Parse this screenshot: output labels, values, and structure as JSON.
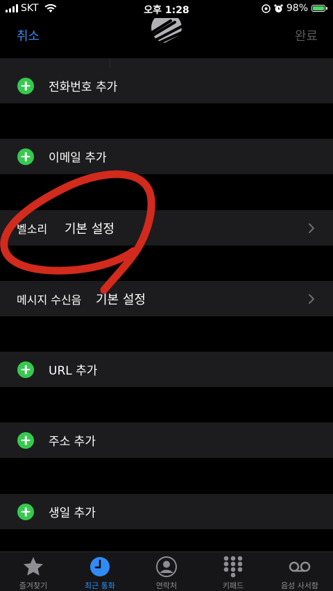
{
  "status_bar": {
    "carrier": "SKT",
    "time": "오후 1:28",
    "battery_percent": "98%",
    "battery_level": 0.98,
    "icons": [
      "signal-icon",
      "wifi-icon",
      "location-icon",
      "alarm-icon",
      "battery-charging-icon"
    ]
  },
  "nav": {
    "cancel_label": "취소",
    "done_label": "완료"
  },
  "rows": {
    "add_phone": "전화번호 추가",
    "add_email": "이메일 추가",
    "ringtone_label": "벨소리",
    "ringtone_value": "기본 설정",
    "text_tone_label": "메시지 수신음",
    "text_tone_value": "기본 설정",
    "add_url": "URL 추가",
    "add_address": "주소 추가",
    "add_birthday": "생일 추가"
  },
  "tab_bar": {
    "active_index": 1,
    "tabs": [
      {
        "label": "즐겨찾기",
        "icon": "star-icon"
      },
      {
        "label": "최근 통화",
        "icon": "clock-icon"
      },
      {
        "label": "연락처",
        "icon": "person-circle-icon"
      },
      {
        "label": "키패드",
        "icon": "keypad-icon"
      },
      {
        "label": "음성 사서함",
        "icon": "voicemail-icon"
      }
    ]
  },
  "colors": {
    "accent": "#2f8cf5",
    "add_green": "#36c94f",
    "row_bg": "#1c1c1e",
    "annotation_red": "#d22a1c"
  }
}
